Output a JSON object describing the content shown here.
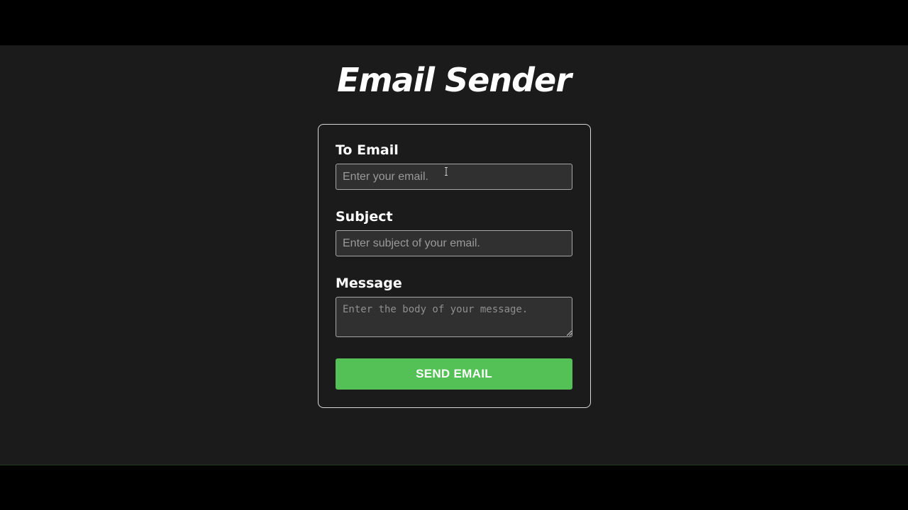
{
  "app": {
    "title": "Email Sender"
  },
  "form": {
    "to_email": {
      "label": "To Email",
      "placeholder": "Enter your email.",
      "value": ""
    },
    "subject": {
      "label": "Subject",
      "placeholder": "Enter subject of your email.",
      "value": ""
    },
    "message": {
      "label": "Message",
      "placeholder": "Enter the body of your message.",
      "value": ""
    },
    "submit_label": "SEND EMAIL"
  },
  "colors": {
    "background": "#1b1b1b",
    "input_background": "#303030",
    "accent_green": "#53c155",
    "text": "#ffffff"
  },
  "icons": {
    "cursor": "text-cursor-icon",
    "resize": "resize-grip-icon"
  }
}
